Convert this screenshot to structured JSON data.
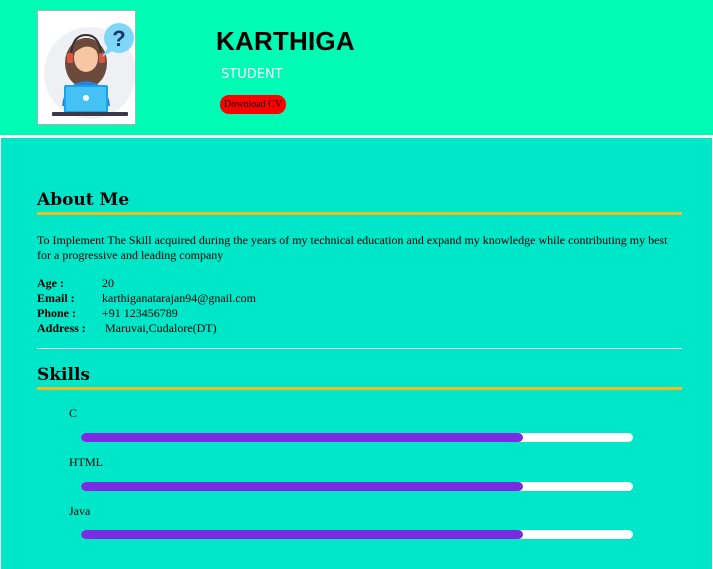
{
  "header": {
    "name": "KARTHIGA",
    "role": "STUDENT",
    "download_label": "Download CV",
    "avatar_icon": "support-agent-question-icon"
  },
  "about": {
    "title": "About Me",
    "text": "To Implement The Skill acquired during the years of my technical education and expand my knowledge while contributing my best for a progressive and leading company",
    "details": [
      {
        "label": "Age :",
        "value": "20"
      },
      {
        "label": "Email :",
        "value": "karthiganatarajan94@gnail.com"
      },
      {
        "label": "Phone :",
        "value": "+91 123456789"
      },
      {
        "label": "Address :",
        "value": " Maruvai,Cudalore(DT)"
      }
    ]
  },
  "skills": {
    "title": "Skills",
    "items": [
      {
        "name": "C",
        "level": 0.8
      },
      {
        "name": "HTML",
        "level": 0.8
      },
      {
        "name": "Java",
        "level": 0.8
      }
    ]
  },
  "colors": {
    "header_bg": "#00fbb4",
    "main_bg": "#00e6c8",
    "accent_line": "#f0be1e",
    "bar_fill": "#7b2be2",
    "button_bg": "#ff0000"
  }
}
